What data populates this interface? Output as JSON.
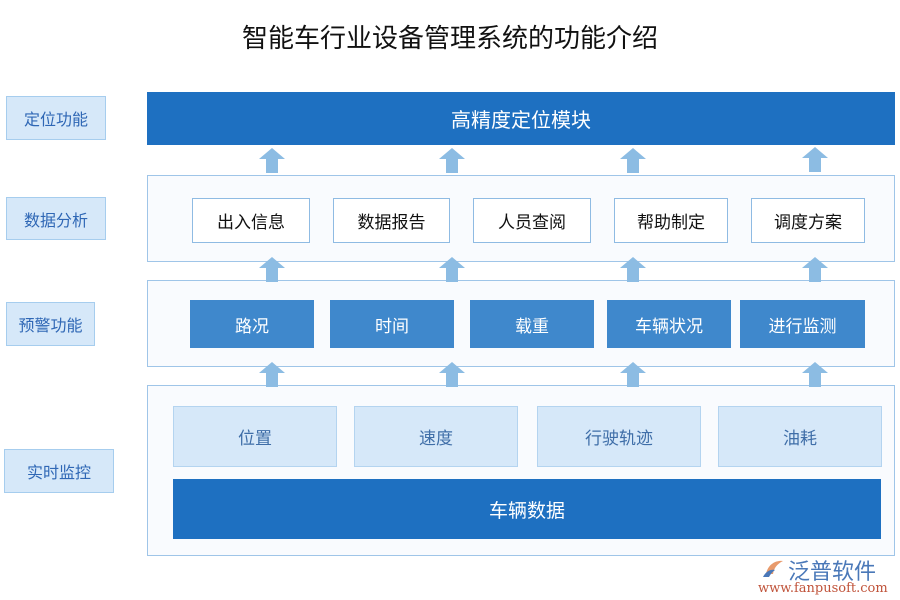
{
  "title": "智能车行业设备管理系统的功能介绍",
  "side_labels": [
    "定位功能",
    "数据分析",
    "预警功能",
    "实时监控"
  ],
  "positioning": {
    "label": "高精度定位模块"
  },
  "analysis": {
    "items": [
      "出入信息",
      "数据报告",
      "人员查阅",
      "帮助制定",
      "调度方案"
    ]
  },
  "warning": {
    "items": [
      "路况",
      "时间",
      "载重",
      "车辆状况",
      "进行监测"
    ]
  },
  "monitoring": {
    "items": [
      "位置",
      "速度",
      "行驶轨迹",
      "油耗"
    ],
    "base_label": "车辆数据"
  },
  "watermark": {
    "brand": "泛普软件",
    "url": "www.fanpusoft.com"
  },
  "colors": {
    "primary": "#1e70c1",
    "mid": "#3f88cc",
    "light": "#d6e8f9",
    "arrow": "#8cbce3"
  }
}
